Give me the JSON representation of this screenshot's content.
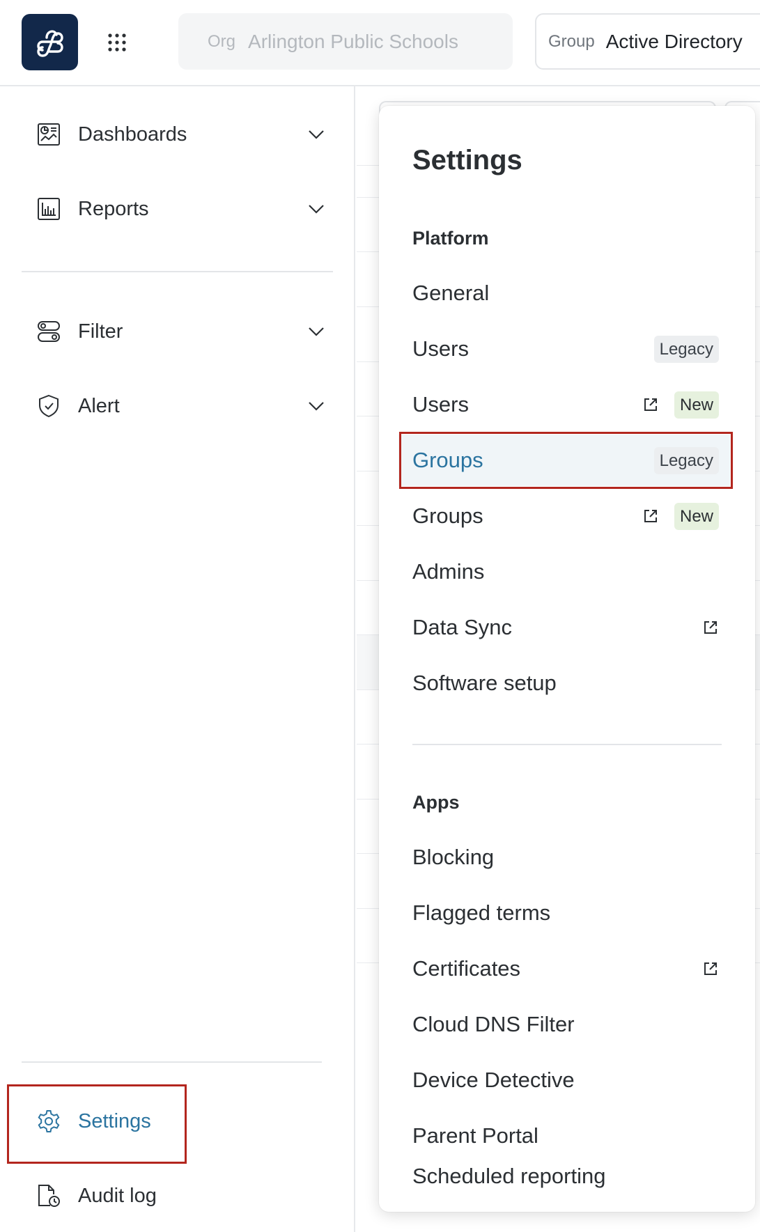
{
  "topbar": {
    "org_label": "Org",
    "org_value": "Arlington Public Schools",
    "group_label": "Group",
    "group_value": "Active Directory",
    "logo_icon": "infinity-loop-logo",
    "apps_icon": "grid-dots-icon"
  },
  "sidebar": {
    "items": [
      {
        "label": "Dashboards",
        "icon": "dashboard-icon"
      },
      {
        "label": "Reports",
        "icon": "bar-chart-icon"
      },
      {
        "label": "Filter",
        "icon": "toggle-filter-icon"
      },
      {
        "label": "Alert",
        "icon": "shield-check-icon"
      }
    ],
    "bottom": [
      {
        "label": "Settings",
        "icon": "gear-icon",
        "active": true
      },
      {
        "label": "Audit log",
        "icon": "document-clock-icon"
      }
    ]
  },
  "settings_menu": {
    "title": "Settings",
    "sections": [
      {
        "heading": "Platform",
        "items": [
          {
            "label": "General"
          },
          {
            "label": "Users",
            "badge": "Legacy"
          },
          {
            "label": "Users",
            "badge": "New",
            "external": true
          },
          {
            "label": "Groups",
            "badge": "Legacy",
            "active": true
          },
          {
            "label": "Groups",
            "badge": "New",
            "external": true
          },
          {
            "label": "Admins"
          },
          {
            "label": "Data Sync",
            "external": true
          },
          {
            "label": "Software setup"
          }
        ]
      },
      {
        "heading": "Apps",
        "items": [
          {
            "label": "Blocking"
          },
          {
            "label": "Flagged terms"
          },
          {
            "label": "Certificates",
            "external": true
          },
          {
            "label": "Cloud DNS Filter"
          },
          {
            "label": "Device Detective"
          },
          {
            "label": "Parent Portal"
          },
          {
            "label": "Scheduled reporting"
          }
        ]
      }
    ]
  },
  "colors": {
    "accent": "#2b74a0",
    "highlight_border": "#b3261e",
    "logo_bg": "#12284a",
    "badge_new_bg": "#e6f1de",
    "badge_legacy_bg": "#eceef0"
  }
}
